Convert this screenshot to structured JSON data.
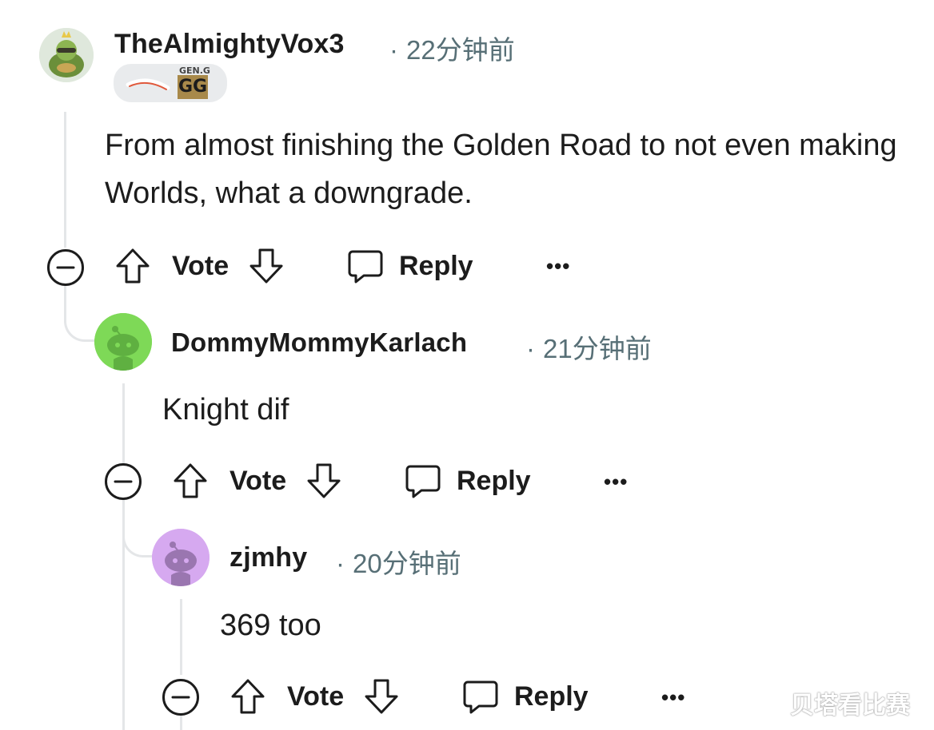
{
  "comments": [
    {
      "username": "TheAlmightyVox3",
      "dot": "·",
      "time": "22分钟前",
      "body": "From almost finishing the Golden Road to not even making Worlds, what a downgrade.",
      "badge_text": "GEN.G",
      "badge_logo": "GG",
      "avatar_icon": "turtle-avatar-icon",
      "actions": {
        "vote": "Vote",
        "reply": "Reply",
        "more": "•••"
      }
    },
    {
      "username": "DommyMommyKarlach",
      "dot": "·",
      "time": "21分钟前",
      "body": "Knight dif",
      "avatar_color": "#7ed957",
      "actions": {
        "vote": "Vote",
        "reply": "Reply",
        "more": "•••"
      }
    },
    {
      "username": "zjmhy",
      "dot": "·",
      "time": "20分钟前",
      "body": "369 too",
      "avatar_color": "#d6a9f0",
      "actions": {
        "vote": "Vote",
        "reply": "Reply",
        "more": "•••"
      }
    }
  ],
  "watermark": "贝塔看比赛",
  "colors": {
    "text": "#1c1c1c",
    "meta": "#576f76",
    "thread": "#e4e6e8"
  }
}
